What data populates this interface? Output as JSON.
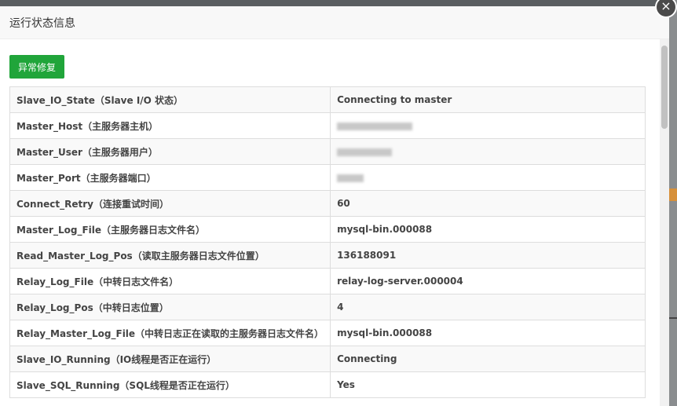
{
  "dialog": {
    "title": "运行状态信息",
    "close_icon": "×",
    "repair_button": "异常修复"
  },
  "rows": [
    {
      "key": "Slave_IO_State（Slave I/O 状态）",
      "value": "Connecting to master"
    },
    {
      "key": "Master_Host（主服务器主机）",
      "value": null,
      "redacted": true
    },
    {
      "key": "Master_User（主服务器用户）",
      "value": null,
      "redacted": true
    },
    {
      "key": "Master_Port（主服务器端口）",
      "value": null,
      "redacted": true
    },
    {
      "key": "Connect_Retry（连接重试时间）",
      "value": "60"
    },
    {
      "key": "Master_Log_File（主服务器日志文件名）",
      "value": "mysql-bin.000088"
    },
    {
      "key": "Read_Master_Log_Pos（读取主服务器日志文件位置）",
      "value": "136188091"
    },
    {
      "key": "Relay_Log_File（中转日志文件名）",
      "value": "relay-log-server.000004"
    },
    {
      "key": "Relay_Log_Pos（中转日志位置）",
      "value": "4"
    },
    {
      "key": "Relay_Master_Log_File（中转日志正在读取的主服务器日志文件名）",
      "value": "mysql-bin.000088"
    },
    {
      "key": "Slave_IO_Running（IO线程是否正在运行）",
      "value": "Connecting"
    },
    {
      "key": "Slave_SQL_Running（SQL线程是否正在运行）",
      "value": "Yes"
    }
  ],
  "colors": {
    "primary": "#20a53a",
    "header_bg": "#f8f8f8",
    "border": "#dddddd"
  }
}
